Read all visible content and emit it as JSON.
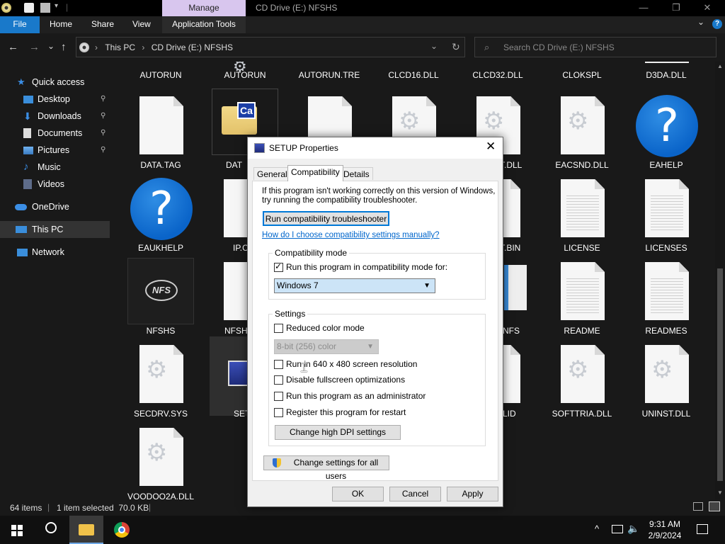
{
  "window": {
    "title": "CD Drive (E:) NFSHS",
    "manage_label": "Manage",
    "minimize": "—",
    "maximize": "❐",
    "close": "✕"
  },
  "ribbon": {
    "tabs": [
      "File",
      "Home",
      "Share",
      "View",
      "Application Tools"
    ],
    "expand": "⌄",
    "help": "?"
  },
  "address": {
    "crumbs": [
      "This PC",
      "CD Drive (E:) NFSHS"
    ],
    "separator": "›",
    "dropdown": "⌄",
    "refresh": "↻"
  },
  "search": {
    "placeholder": "Search CD Drive (E:) NFSHS"
  },
  "nav": {
    "back": "←",
    "forward": "→",
    "recent": "⌄",
    "up": "↑",
    "quick_access": "Quick access",
    "desktop": "Desktop",
    "downloads": "Downloads",
    "documents": "Documents",
    "pictures": "Pictures",
    "music": "Music",
    "videos": "Videos",
    "onedrive": "OneDrive",
    "this_pc": "This PC",
    "network": "Network",
    "pin": "📌"
  },
  "files": {
    "row0": [
      "AUTORUN",
      "AUTORUN",
      "AUTORUN.TRE",
      "CLCD16.DLL",
      "CLCD32.DLL",
      "CLOKSPL",
      "D3DA.DLL"
    ],
    "row1": [
      "DATA.TAG",
      "DAT",
      "",
      "",
      "T.DLL",
      "EACSND.DLL",
      "EAHELP"
    ],
    "row2": [
      "EAUKHELP",
      "IP.C",
      "",
      "",
      "T.BIN",
      "LICENSE",
      "LICENSES"
    ],
    "row3": [
      "NFSHS",
      "NFSHS",
      "",
      "",
      "NFS",
      "README",
      "READMES"
    ],
    "row4": [
      "SECDRV.SYS",
      "SETU",
      "",
      "",
      "LID",
      "SOFTTRIA.DLL",
      "UNINST.DLL"
    ],
    "row5": [
      "VOODOO2A.DLL"
    ],
    "nfs_logo": "NFS",
    "cab_badge": "Ca",
    "help_glyph": "?",
    "gear_glyph": "⚙"
  },
  "status": {
    "items": "64 items",
    "selected": "1 item selected  70.0 KB"
  },
  "taskbar": {
    "time": "9:31 AM",
    "date": "2/9/2024"
  },
  "dialog": {
    "title": "SETUP Properties",
    "close": "✕",
    "tabs": [
      "General",
      "Compatibility",
      "Details"
    ],
    "intro_line1": "If this program isn't working correctly on this version of Windows,",
    "intro_line2": "try running the compatibility troubleshooter.",
    "troubleshooter_button": "Run compatibility troubleshooter",
    "manual_link": "How do I choose compatibility settings manually?",
    "compat_group": "Compatibility mode",
    "compat_checkbox": "Run this program in compatibility mode for:",
    "compat_checked": true,
    "compat_select": "Windows 7",
    "settings_group": "Settings",
    "reduced_color": "Reduced color mode",
    "color_select": "8-bit (256) color",
    "resolution_640": "Run in 640 x 480 screen resolution",
    "disable_fullscreen": "Disable fullscreen optimizations",
    "run_admin": "Run this program as an administrator",
    "register_restart": "Register this program for restart",
    "dpi_button": "Change high DPI settings",
    "all_users_button": "Change settings for all users",
    "ok": "OK",
    "cancel": "Cancel",
    "apply": "Apply"
  }
}
